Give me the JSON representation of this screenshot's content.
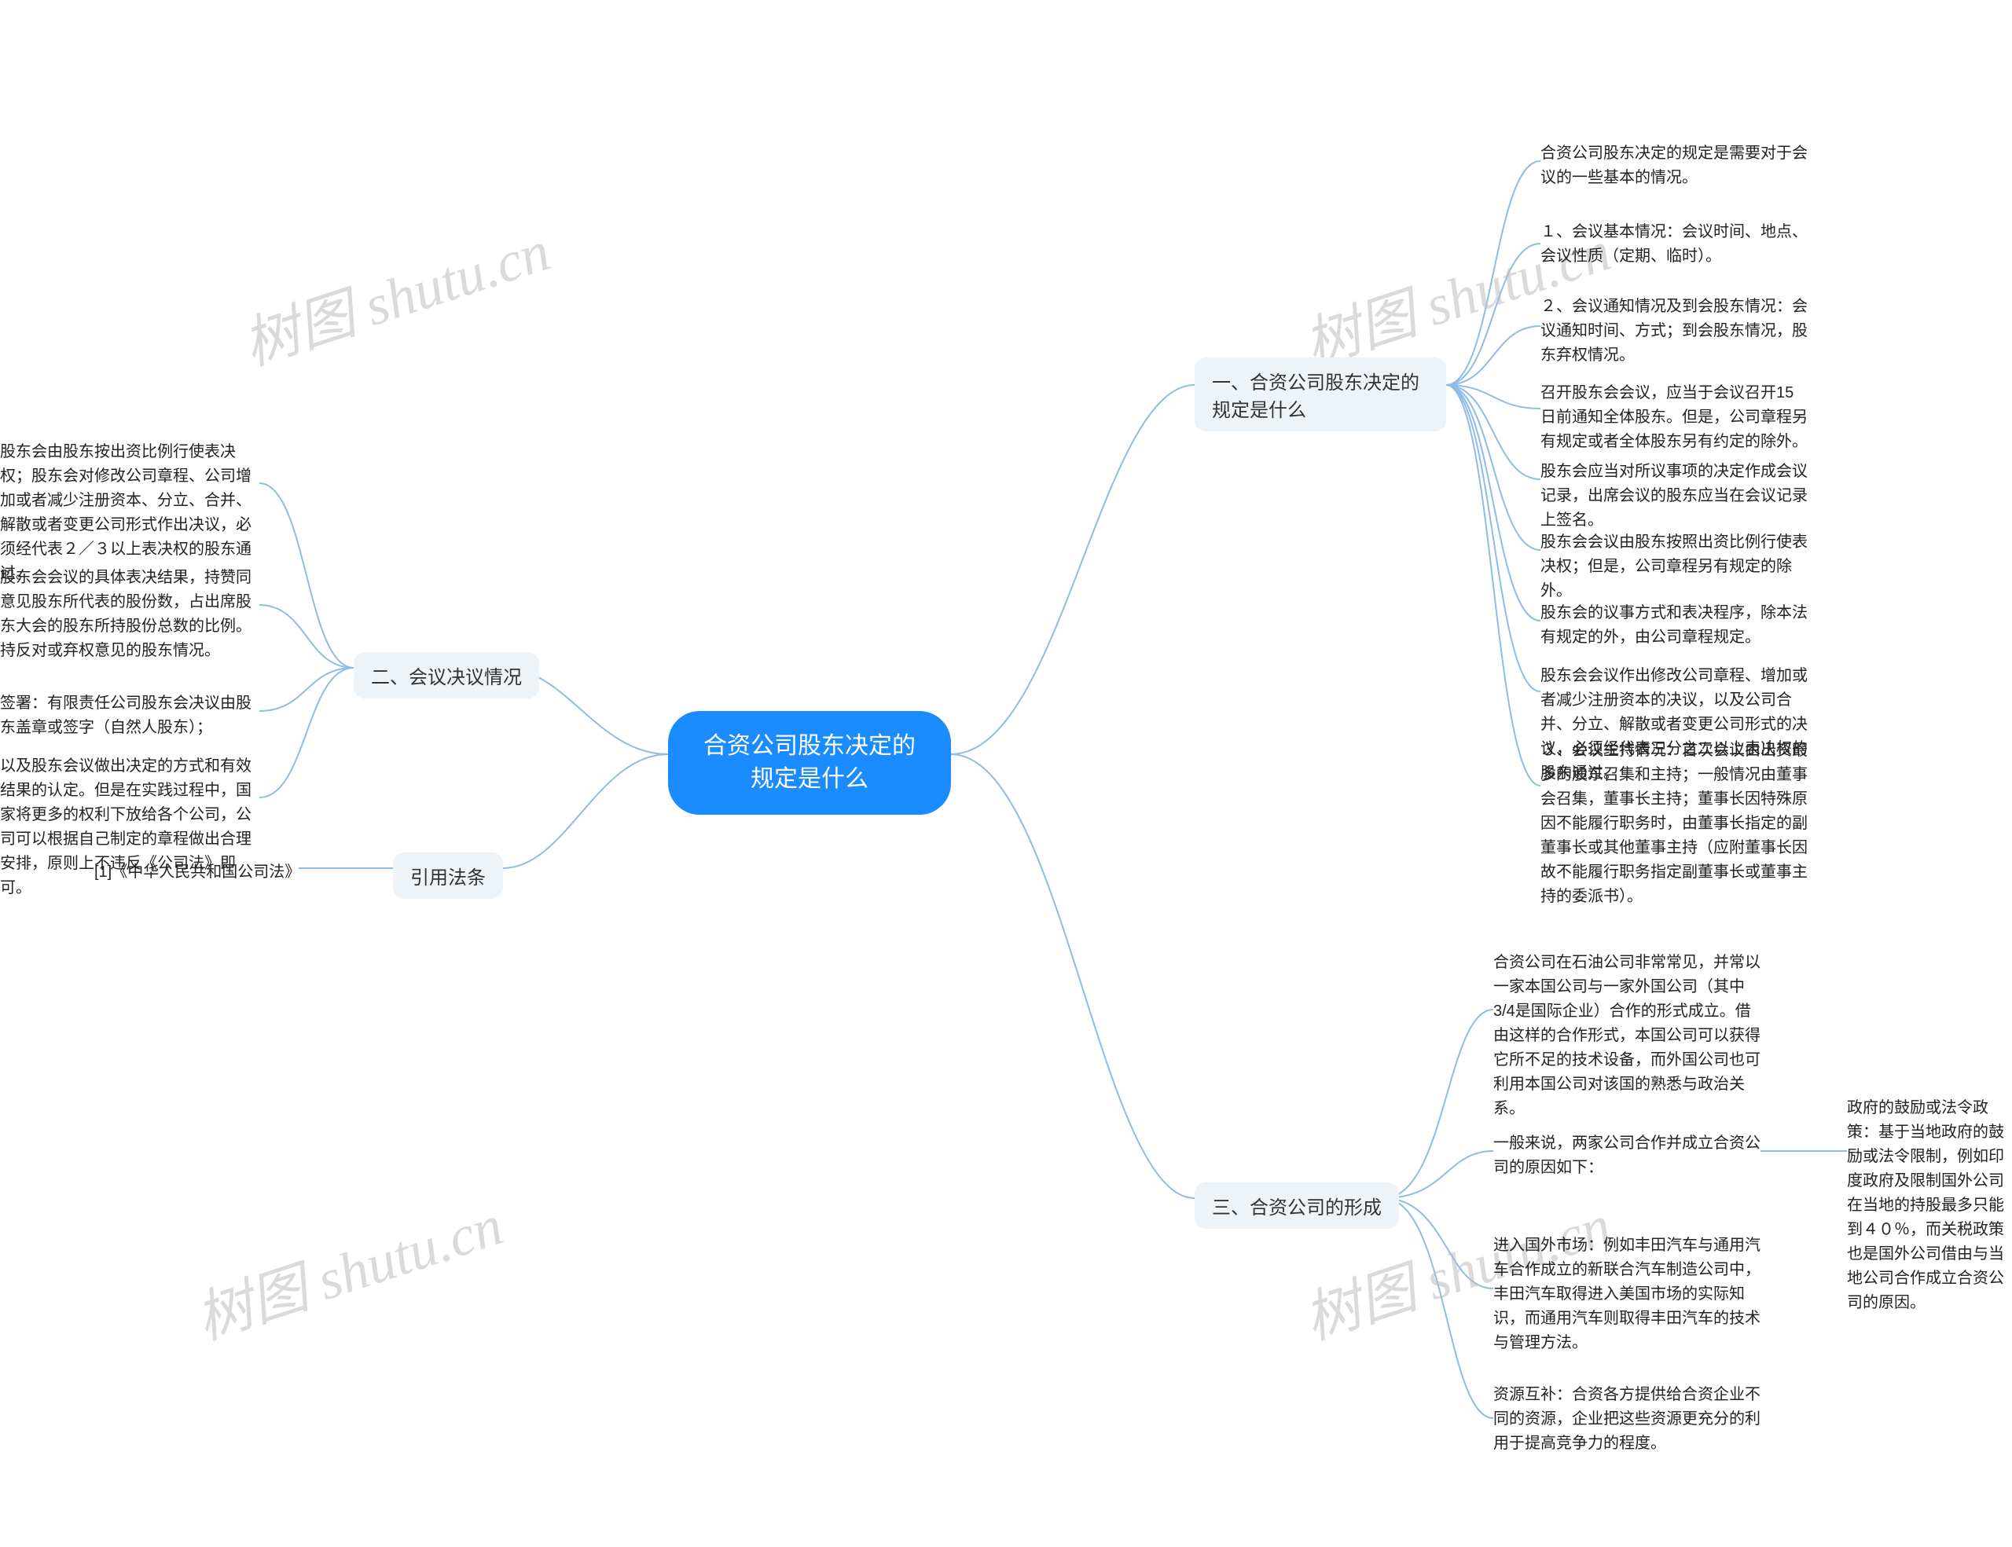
{
  "watermark": "树图 shutu.cn",
  "center": "合资公司股东决定的规定是什么",
  "sections": {
    "s1": {
      "title": "一、合资公司股东决定的规定是什么",
      "items": [
        "合资公司股东决定的规定是需要对于会议的一些基本的情况。",
        "１、会议基本情况：会议时间、地点、会议性质（定期、临时）。",
        "２、会议通知情况及到会股东情况：会议通知时间、方式；到会股东情况，股东弃权情况。",
        "召开股东会会议，应当于会议召开15日前通知全体股东。但是，公司章程另有规定或者全体股东另有约定的除外。",
        "股东会应当对所议事项的决定作成会议记录，出席会议的股东应当在会议记录上签名。",
        "股东会会议由股东按照出资比例行使表决权；但是，公司章程另有规定的除外。",
        "股东会的议事方式和表决程序，除本法有规定的外，由公司章程规定。",
        "股东会会议作出修改公司章程、增加或者减少注册资本的决议，以及公司合并、分立、解散或者变更公司形式的决议，必须经代表三分之二以上表决权的股东通过。",
        "３、会议主持情况：首次会议由出资最多的股东召集和主持；一般情况由董事会召集，董事长主持；董事长因特殊原因不能履行职务时，由董事长指定的副董事长或其他董事主持（应附董事长因故不能履行职务指定副董事长或董事主持的委派书）。"
      ]
    },
    "s2": {
      "title": "二、会议决议情况",
      "items": [
        "股东会由股东按出资比例行使表决权；股东会对修改公司章程、公司增加或者减少注册资本、分立、合并、解散或者变更公司形式作出决议，必须经代表２／３以上表决权的股东通过。",
        "股东会会议的具体表决结果，持赞同意见股东所代表的股份数，占出席股东大会的股东所持股份总数的比例。持反对或弃权意见的股东情况。",
        "签署：有限责任公司股东会决议由股东盖章或签字（自然人股东）；",
        "以及股东会议做出决定的方式和有效结果的认定。但是在实践过程中，国家将更多的权利下放给各个公司，公司可以根据自己制定的章程做出合理安排，原则上不违反《公司法》即可。"
      ]
    },
    "s3": {
      "title": "三、合资公司的形成",
      "items": [
        "合资公司在石油公司非常常见，并常以一家本国公司与一家外国公司（其中3/4是国际企业）合作的形式成立。借由这样的合作形式，本国公司可以获得它所不足的技术设备，而外国公司也可利用本国公司对该国的熟悉与政治关系。",
        "一般来说，两家公司合作并成立合资公司的原因如下：",
        "进入国外市场：例如丰田汽车与通用汽车合作成立的新联合汽车制造公司中，丰田汽车取得进入美国市场的实际知识，而通用汽车则取得丰田汽车的技术与管理方法。",
        "资源互补：合资各方提供给合资企业不同的资源，企业把这些资源更充分的利用于提高竞争力的程度。"
      ],
      "sub": [
        "政府的鼓励或法令政策：基于当地政府的鼓励或法令限制，例如印度政府及限制国外公司在当地的持股最多只能到４０％，而关税政策也是国外公司借由与当地公司合作成立合资公司的原因。"
      ]
    },
    "cite": {
      "title": "引用法条",
      "items": [
        "[1]《中华人民共和国公司法》"
      ]
    }
  }
}
